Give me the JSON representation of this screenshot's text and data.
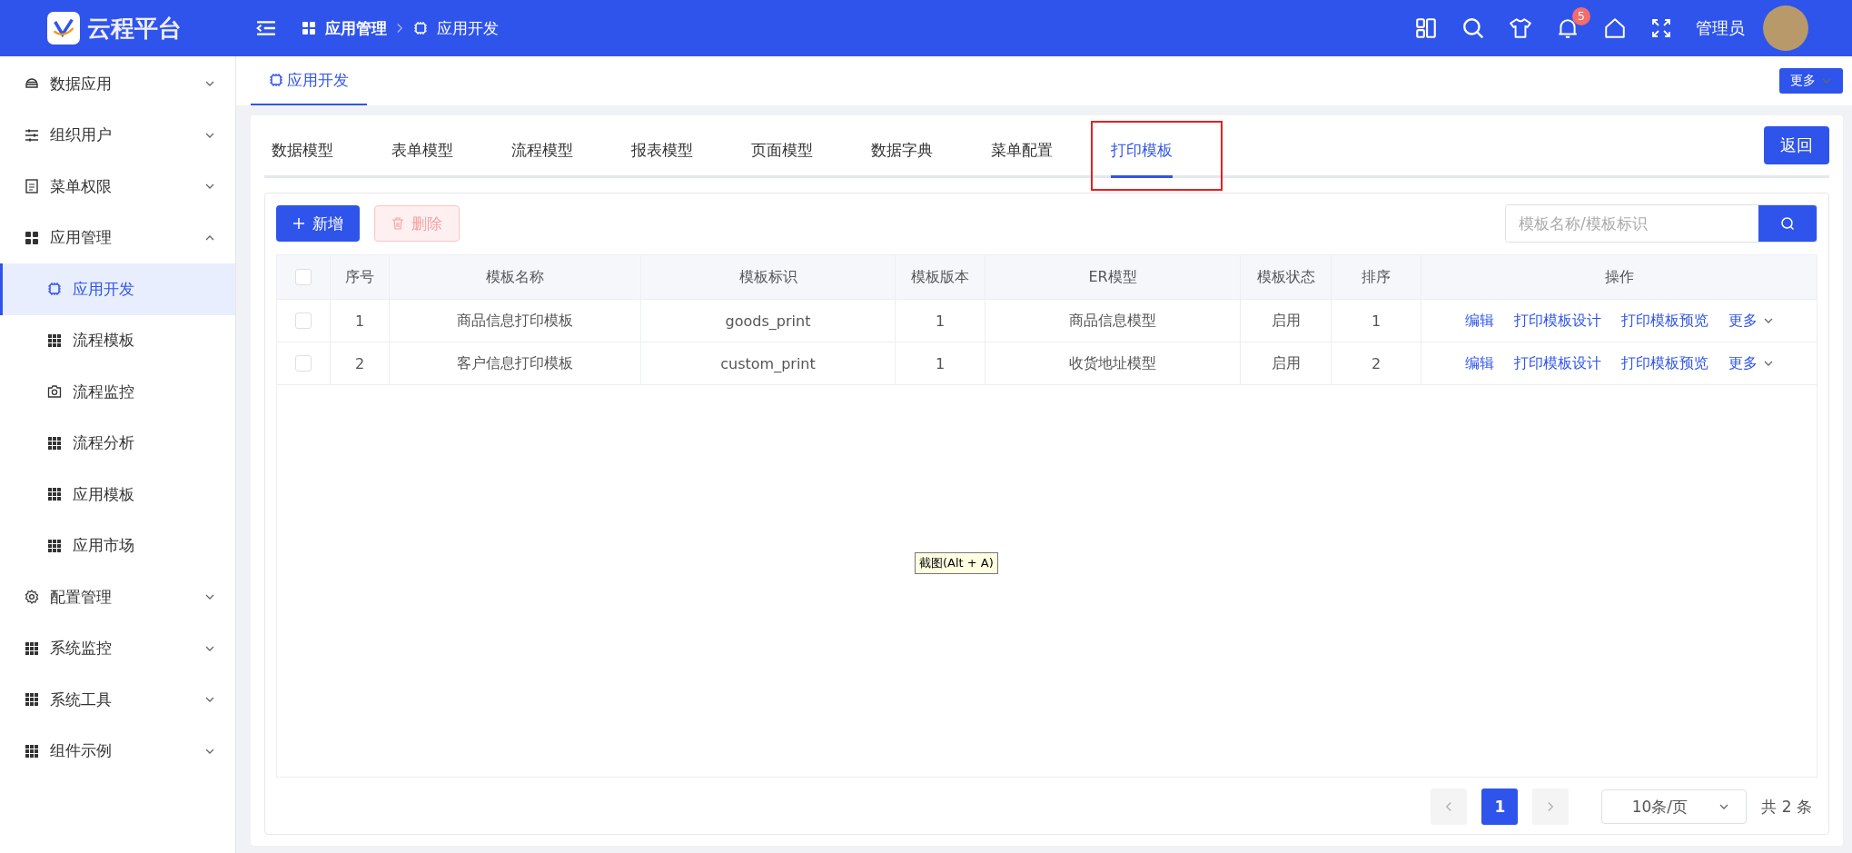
{
  "header": {
    "logo_text": "云程平台",
    "breadcrumb": [
      {
        "label": "应用管理",
        "current": false
      },
      {
        "label": "应用开发",
        "current": true
      }
    ],
    "notification_count": "5",
    "user_name": "管理员"
  },
  "sidebar": {
    "items": [
      {
        "label": "数据应用",
        "expanded": false
      },
      {
        "label": "组织用户",
        "expanded": false
      },
      {
        "label": "菜单权限",
        "expanded": false
      },
      {
        "label": "应用管理",
        "expanded": true,
        "children": [
          {
            "label": "应用开发",
            "selected": true
          },
          {
            "label": "流程模板",
            "selected": false
          },
          {
            "label": "流程监控",
            "selected": false
          },
          {
            "label": "流程分析",
            "selected": false
          },
          {
            "label": "应用模板",
            "selected": false
          },
          {
            "label": "应用市场",
            "selected": false
          }
        ]
      },
      {
        "label": "配置管理",
        "expanded": false
      },
      {
        "label": "系统监控",
        "expanded": false
      },
      {
        "label": "系统工具",
        "expanded": false
      },
      {
        "label": "组件示例",
        "expanded": false
      }
    ]
  },
  "page_tabs": [
    {
      "label": "应用开发",
      "selected": true
    }
  ],
  "more_button": "更多",
  "module_tabs": [
    {
      "label": "数据模型",
      "selected": false,
      "highlighted": false
    },
    {
      "label": "表单模型",
      "selected": false,
      "highlighted": false
    },
    {
      "label": "流程模型",
      "selected": false,
      "highlighted": false
    },
    {
      "label": "报表模型",
      "selected": false,
      "highlighted": false
    },
    {
      "label": "页面模型",
      "selected": false,
      "highlighted": false
    },
    {
      "label": "数据字典",
      "selected": false,
      "highlighted": false
    },
    {
      "label": "菜单配置",
      "selected": false,
      "highlighted": false
    },
    {
      "label": "打印模板",
      "selected": true,
      "highlighted": true
    }
  ],
  "back_button": "返回",
  "toolbar": {
    "add_button": "新增",
    "delete_button": {
      "label": "删除",
      "disabled": true
    },
    "search": {
      "placeholder": "模板名称/模板标识"
    }
  },
  "table": {
    "select_all_checked": false,
    "columns": [
      "序号",
      "模板名称",
      "模板标识",
      "模板版本",
      "ER模型",
      "模板状态",
      "排序",
      "操作"
    ],
    "rows": [
      {
        "checked": false,
        "cells": [
          "1",
          "商品信息打印模板",
          "goods_print",
          "1",
          "商品信息模型",
          "启用",
          "1"
        ],
        "actions": [
          "编辑",
          "打印模板设计",
          "打印模板预览",
          "更多"
        ]
      },
      {
        "checked": false,
        "cells": [
          "2",
          "客户信息打印模板",
          "custom_print",
          "1",
          "收货地址模型",
          "启用",
          "2"
        ],
        "actions": [
          "编辑",
          "打印模板设计",
          "打印模板预览",
          "更多"
        ]
      }
    ]
  },
  "pagination": {
    "pages": [
      {
        "label": "1",
        "selected": true
      }
    ],
    "page_size": "10条/页",
    "total": "共 2 条"
  },
  "tooltip": "截图(Alt + A)"
}
